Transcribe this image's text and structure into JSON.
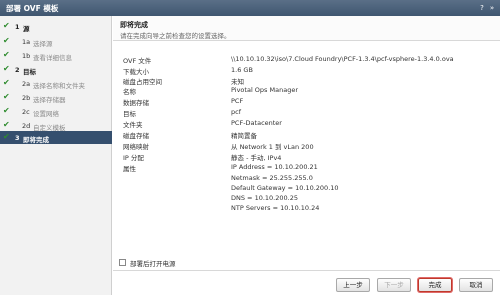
{
  "window": {
    "title": "部署 OVF 模板",
    "controls": [
      "?",
      "»"
    ]
  },
  "sidebar": {
    "steps": [
      {
        "num": "1",
        "label": "源",
        "group": true,
        "done": true
      },
      {
        "num": "1a",
        "label": "选择源",
        "group": false,
        "done": true
      },
      {
        "num": "1b",
        "label": "查看详细信息",
        "group": false,
        "done": true
      },
      {
        "num": "2",
        "label": "目标",
        "group": true,
        "done": true
      },
      {
        "num": "2a",
        "label": "选择名称和文件夹",
        "group": false,
        "done": true
      },
      {
        "num": "2b",
        "label": "选择存储器",
        "group": false,
        "done": true
      },
      {
        "num": "2c",
        "label": "设置网络",
        "group": false,
        "done": true
      },
      {
        "num": "2d",
        "label": "自定义模板",
        "group": false,
        "done": true
      },
      {
        "num": "3",
        "label": "即将完成",
        "group": true,
        "done": true,
        "active": true
      }
    ]
  },
  "main": {
    "header_title": "即将完成",
    "header_subtitle": "请在完成向导之前检查您的设置选择。",
    "rows": [
      {
        "key": "OVF 文件",
        "value": "\\\\10.10.10.32\\iso\\7.Cloud Foundry\\PCF-1.3.4\\pcf-vsphere-1.3.4.0.ova"
      },
      {
        "key": "下载大小",
        "value": "1.6 GB"
      },
      {
        "key": "磁盘占用空间",
        "value": "未知"
      },
      {
        "key": "名称",
        "value": "Pivotal Ops Manager"
      },
      {
        "key": "数据存储",
        "value": "PCF"
      },
      {
        "key": "目标",
        "value": "pcf"
      },
      {
        "key": "文件夹",
        "value": "PCF-Datacenter"
      },
      {
        "key": "磁盘存储",
        "value": "精简置备"
      },
      {
        "key": "网络映射",
        "value": "从 Network 1 到 vLan 200"
      },
      {
        "key": "IP 分配",
        "value": "静态 - 手动, IPv4"
      },
      {
        "key": "属性",
        "value": "IP Address = 10.10.200.21"
      },
      {
        "key": "",
        "value": "Netmask = 25.255.255.0"
      },
      {
        "key": "",
        "value": "Default Gateway = 10.10.200.10"
      },
      {
        "key": "",
        "value": "DNS = 10.10.200.25"
      },
      {
        "key": "",
        "value": "NTP Servers = 10.10.10.24"
      }
    ],
    "power_on_label": "部署后打开电源"
  },
  "buttons": {
    "back": "上一步",
    "next": "下一步",
    "finish": "完成",
    "cancel": "取消"
  },
  "colors": {
    "titlebar": "#4a6078",
    "active_step": "#354f6e",
    "check": "#2e8b2e"
  }
}
